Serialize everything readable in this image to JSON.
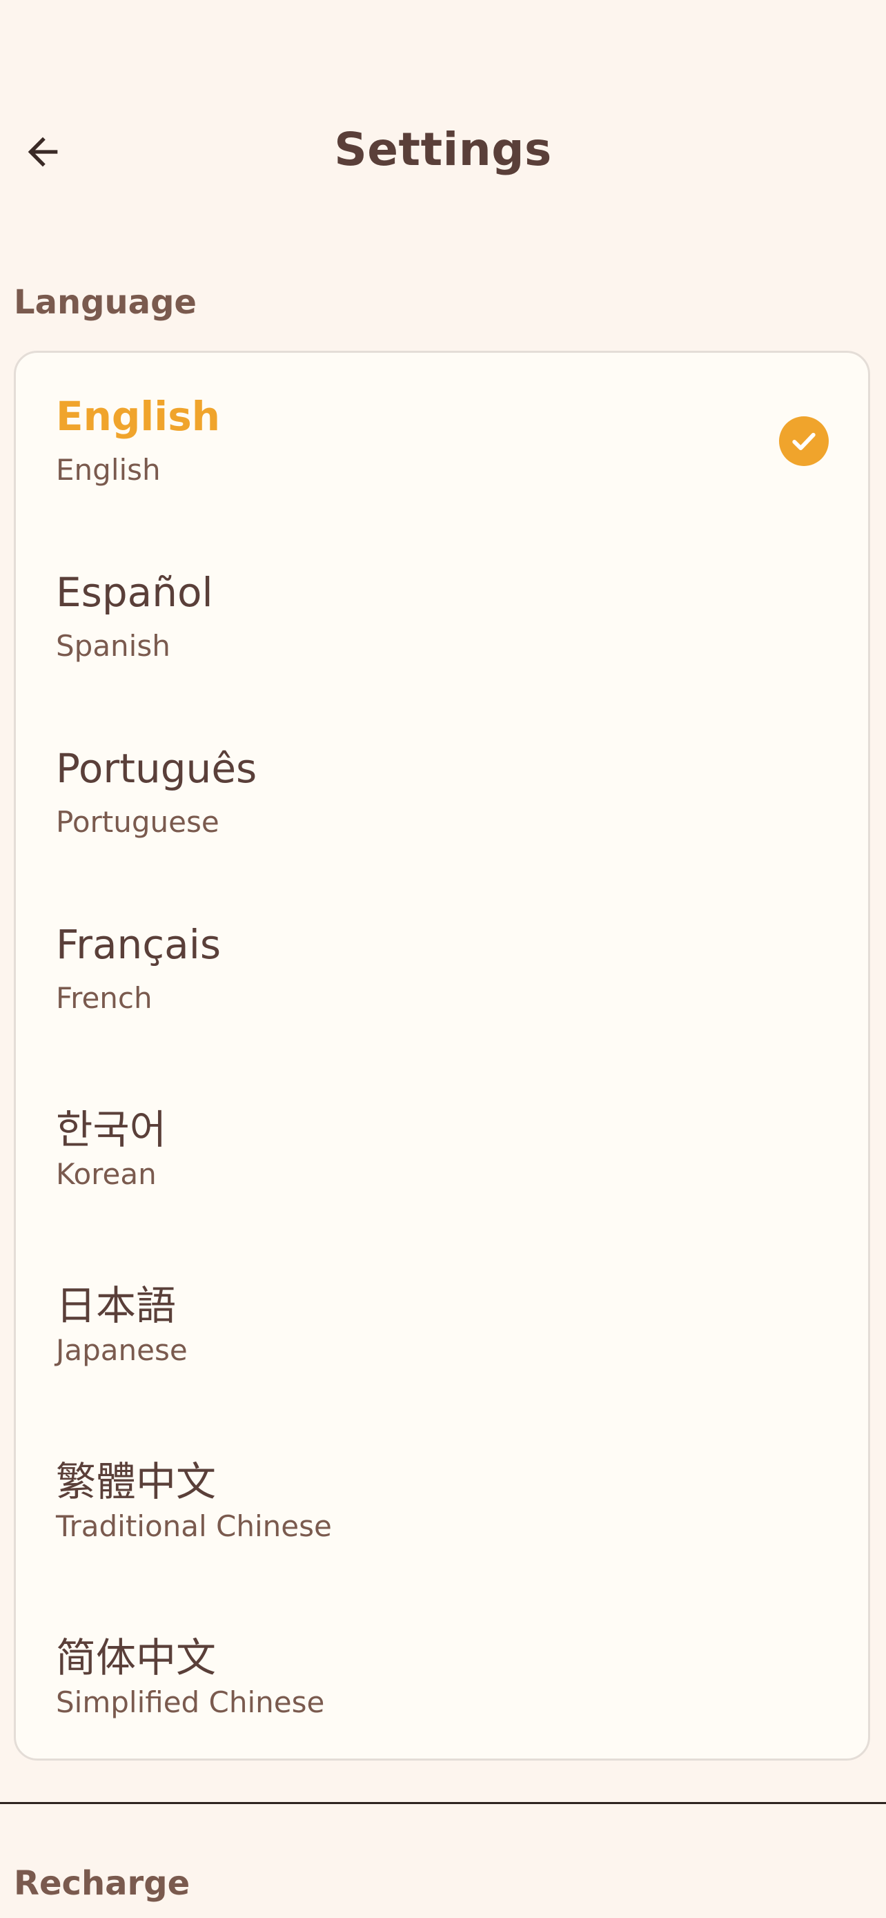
{
  "header": {
    "title": "Settings",
    "back_icon": "arrow-left-icon"
  },
  "language_section": {
    "label": "Language",
    "selected": "English",
    "items": [
      {
        "native": "English",
        "english": "English",
        "selected": true
      },
      {
        "native": "Español",
        "english": "Spanish",
        "selected": false
      },
      {
        "native": "Português",
        "english": "Portuguese",
        "selected": false
      },
      {
        "native": "Français",
        "english": "French",
        "selected": false
      },
      {
        "native": "한국어",
        "english": "Korean",
        "selected": false
      },
      {
        "native": "日本語",
        "english": "Japanese",
        "selected": false
      },
      {
        "native": "繁體中文",
        "english": "Traditional Chinese",
        "selected": false
      },
      {
        "native": "简体中文",
        "english": "Simplified Chinese",
        "selected": false
      }
    ]
  },
  "recharge_section": {
    "label": "Recharge"
  },
  "colors": {
    "background": "#fdf5ee",
    "card": "#fffcf6",
    "accent": "#f0a42c",
    "text_primary": "#5a3f39",
    "text_secondary": "#7a5a4e"
  }
}
